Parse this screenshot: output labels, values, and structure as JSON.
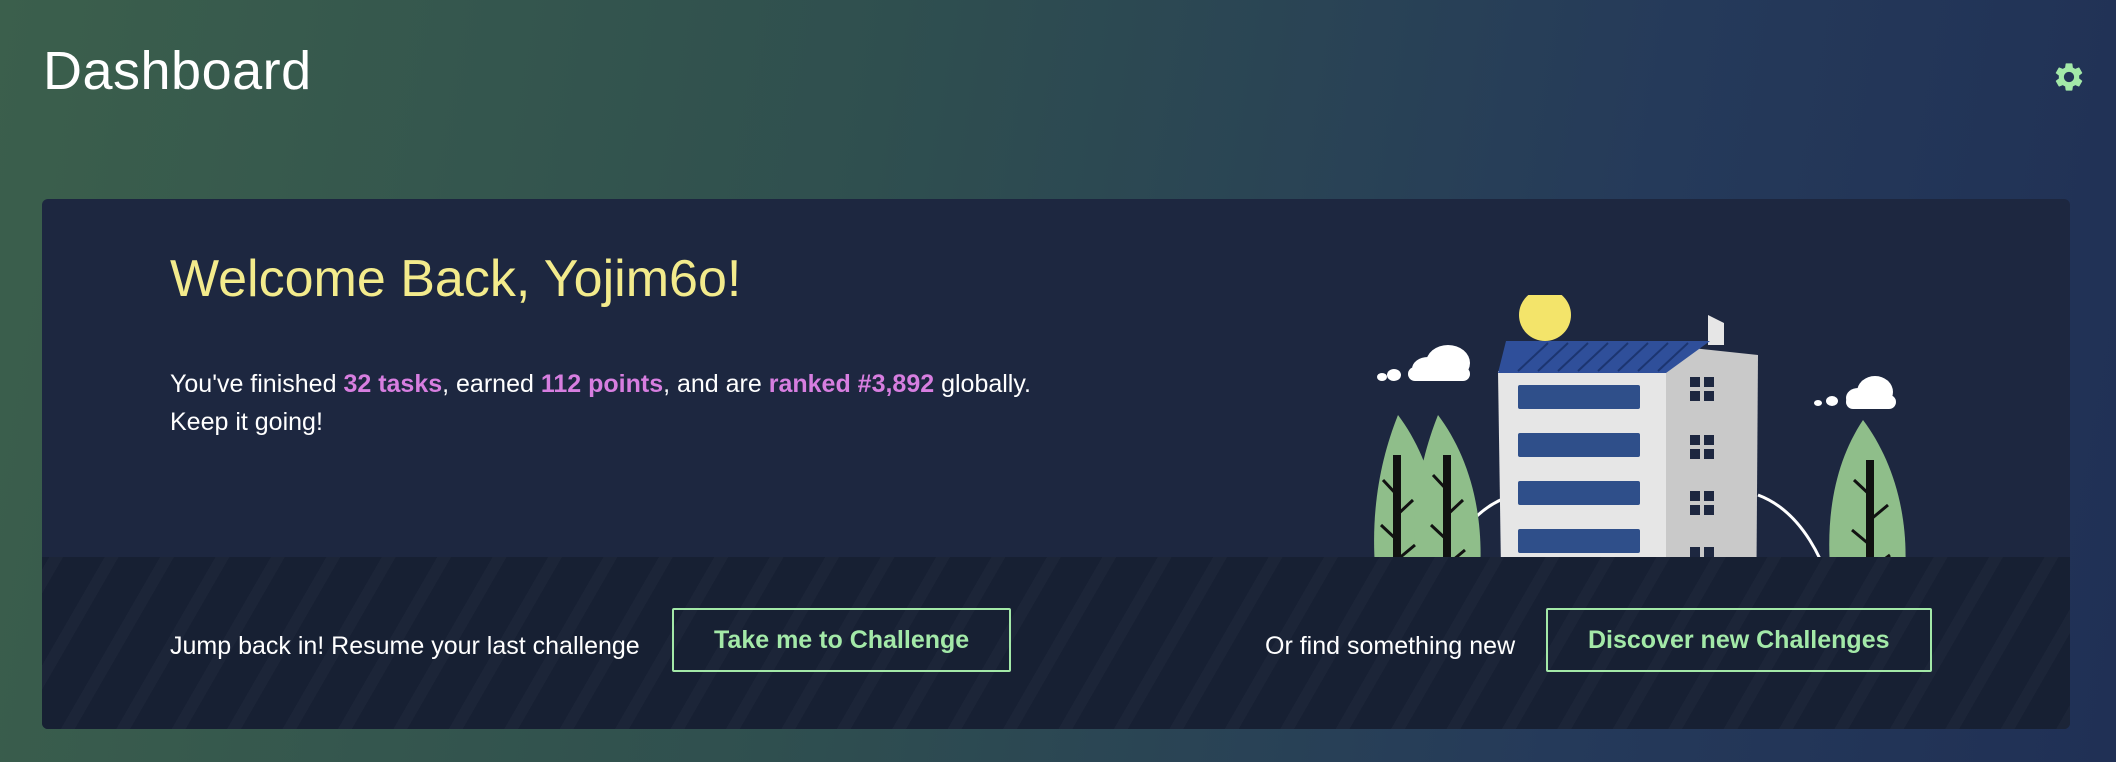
{
  "header": {
    "title": "Dashboard",
    "settings_icon": "gear-icon",
    "accent_color": "#a3e9a8"
  },
  "welcome": {
    "heading": "Welcome Back, Yojim6o!",
    "text_1": "You've finished ",
    "tasks": "32 tasks",
    "text_2": ", earned ",
    "points": "112 points",
    "text_3": ", and are ",
    "rank": "ranked #3,892",
    "text_4": " globally.",
    "text_5": "Keep it going!",
    "highlight_color": "#d77ee0",
    "heading_color": "#f3eb8c"
  },
  "footer": {
    "resume_text": "Jump back in! Resume your last challenge",
    "resume_button": "Take me to Challenge",
    "discover_text": "Or find something new",
    "discover_button": "Discover new Challenges"
  }
}
